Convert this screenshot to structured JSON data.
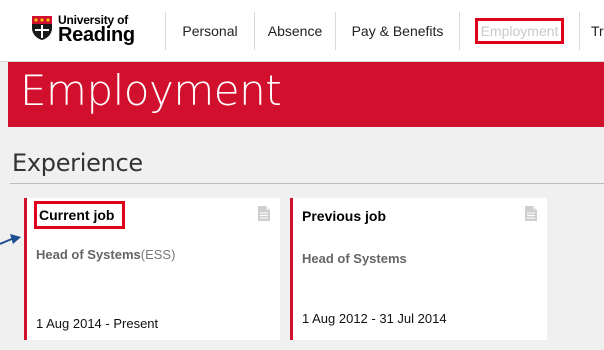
{
  "header": {
    "logo": {
      "line1": "University of",
      "line2": "Reading"
    },
    "nav": [
      {
        "label": "Personal"
      },
      {
        "label": "Absence"
      },
      {
        "label": "Pay & Benefits"
      },
      {
        "label": "Employment",
        "active": true
      },
      {
        "label": "Tr"
      }
    ]
  },
  "banner": {
    "title": "Employment"
  },
  "section": {
    "title": "Experience"
  },
  "cards": [
    {
      "heading": "Current job",
      "role": "Head of Systems",
      "dept": "(ESS)",
      "dates": "1 Aug 2014 - Present"
    },
    {
      "heading": "Previous job",
      "role": "Head of Systems",
      "dates": "1 Aug 2012 - 31 Jul 2014"
    }
  ],
  "colors": {
    "brand_red": "#d1102d",
    "highlight_red": "#e0001b",
    "background": "#f0f0f0"
  },
  "icons": {
    "card_icon": "document-icon",
    "pointer": "arrow-right-icon"
  }
}
